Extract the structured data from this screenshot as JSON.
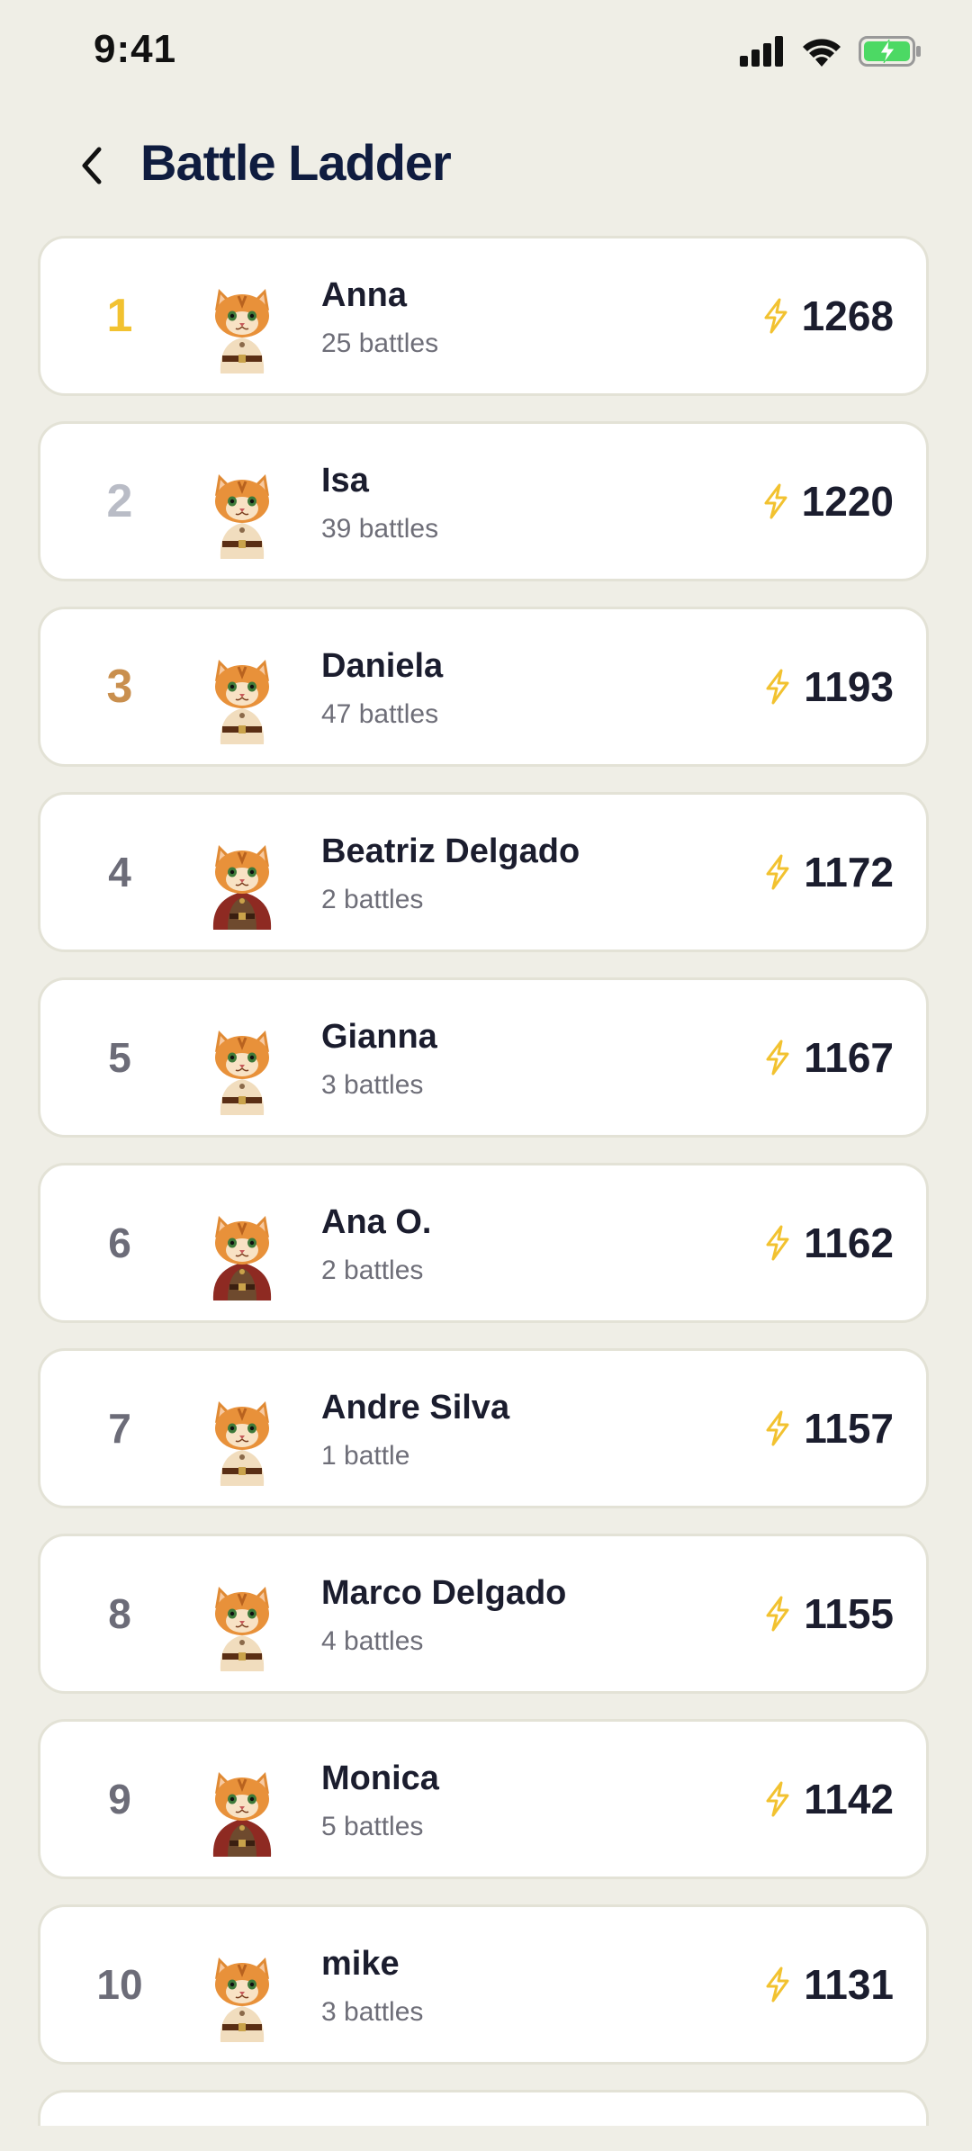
{
  "status_bar": {
    "time": "9:41"
  },
  "header": {
    "title": "Battle Ladder"
  },
  "colors": {
    "background": "#EFEEE6",
    "gold": "#F2C230",
    "silver": "#B9BCC6",
    "bronze": "#C98F4E",
    "bolt": "#F2C230",
    "title": "#0f1c3f"
  },
  "players": [
    {
      "rank": "1",
      "name": "Anna",
      "battles": "25 battles",
      "score": "1268",
      "avatar": "cat-light-tunic-icon"
    },
    {
      "rank": "2",
      "name": "Isa",
      "battles": "39 battles",
      "score": "1220",
      "avatar": "cat-light-tunic-icon"
    },
    {
      "rank": "3",
      "name": "Daniela",
      "battles": "47 battles",
      "score": "1193",
      "avatar": "cat-light-tunic-icon"
    },
    {
      "rank": "4",
      "name": "Beatriz Delgado",
      "battles": "2 battles",
      "score": "1172",
      "avatar": "cat-red-cape-icon"
    },
    {
      "rank": "5",
      "name": "Gianna",
      "battles": "3 battles",
      "score": "1167",
      "avatar": "cat-light-tunic-icon"
    },
    {
      "rank": "6",
      "name": "Ana O.",
      "battles": "2 battles",
      "score": "1162",
      "avatar": "cat-red-cape-icon"
    },
    {
      "rank": "7",
      "name": "Andre Silva",
      "battles": "1 battle",
      "score": "1157",
      "avatar": "cat-light-tunic-icon"
    },
    {
      "rank": "8",
      "name": "Marco Delgado",
      "battles": "4 battles",
      "score": "1155",
      "avatar": "cat-light-tunic-icon"
    },
    {
      "rank": "9",
      "name": "Monica",
      "battles": "5 battles",
      "score": "1142",
      "avatar": "cat-red-cape-icon"
    },
    {
      "rank": "10",
      "name": "mike",
      "battles": "3 battles",
      "score": "1131",
      "avatar": "cat-light-tunic-icon"
    }
  ]
}
